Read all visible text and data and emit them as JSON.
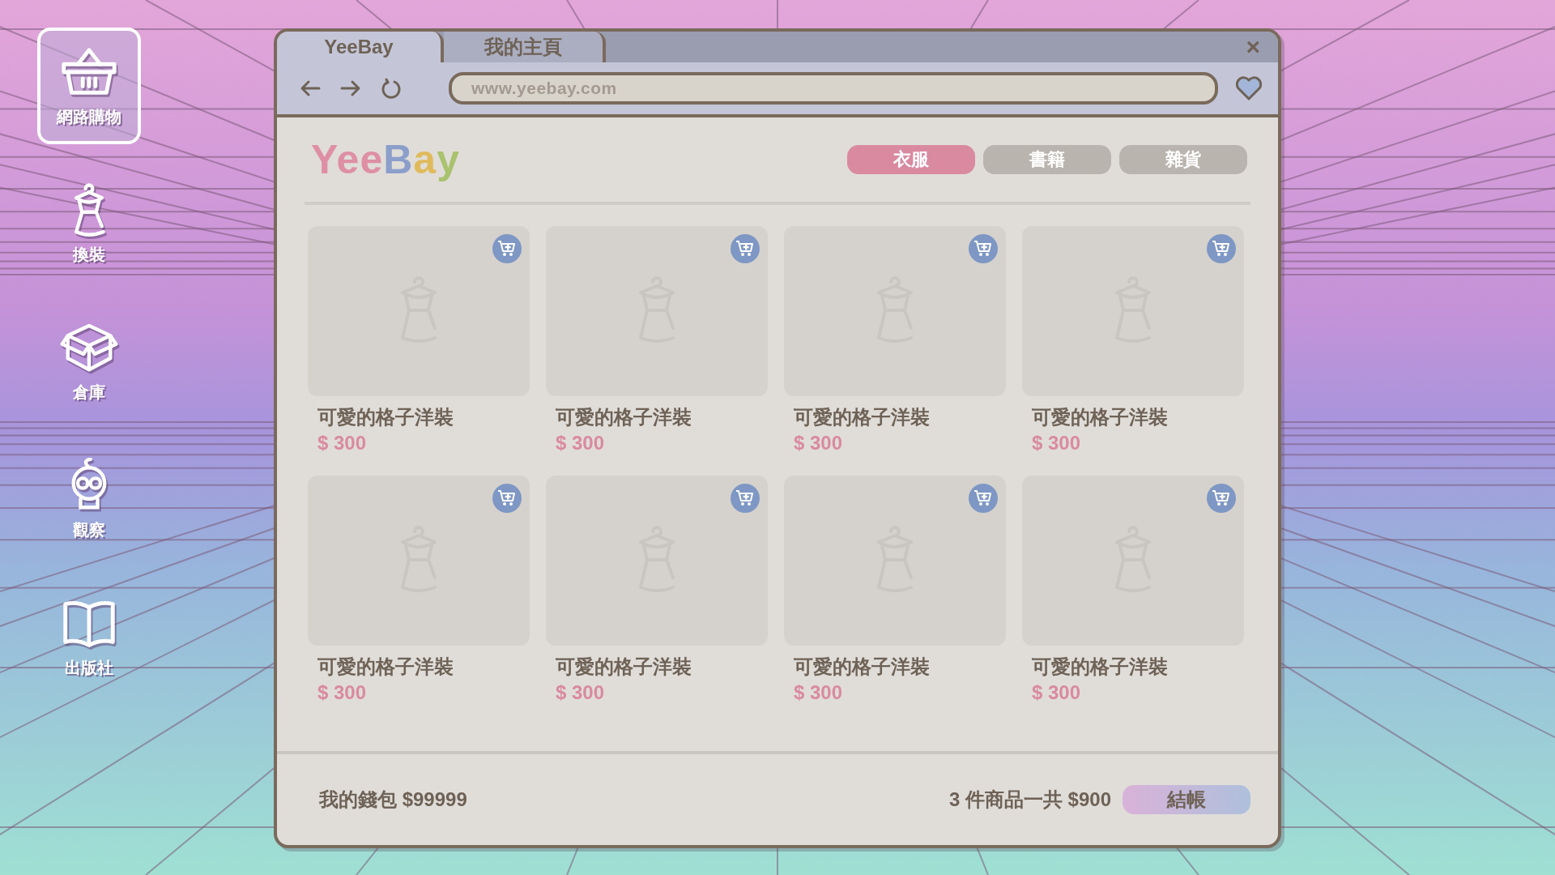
{
  "sidebar": {
    "items": [
      {
        "kind": "basket",
        "label": "網路購物",
        "selected": true
      },
      {
        "kind": "dress",
        "label": "換裝",
        "selected": false
      },
      {
        "kind": "box",
        "label": "倉庫",
        "selected": false
      },
      {
        "kind": "person",
        "label": "觀察",
        "selected": false
      },
      {
        "kind": "book",
        "label": "出版社",
        "selected": false
      }
    ]
  },
  "browser": {
    "tabs": [
      {
        "label": "YeeBay",
        "selected": true
      },
      {
        "label": "我的主頁",
        "selected": false
      }
    ],
    "close": "×",
    "url": "www.yeebay.com"
  },
  "shop": {
    "logo": [
      {
        "text": "Yee",
        "color": "#de8fa6"
      },
      {
        "text": "B",
        "color": "#8c9fca"
      },
      {
        "text": "a",
        "color": "#e0bb5c"
      },
      {
        "text": "y",
        "color": "#a9c26d"
      }
    ],
    "categories": [
      {
        "label": "衣服",
        "selected": true
      },
      {
        "label": "書籍",
        "selected": false
      },
      {
        "label": "雜貨",
        "selected": false
      }
    ],
    "products": [
      {
        "name": "可愛的格子洋裝",
        "price": "$ 300"
      },
      {
        "name": "可愛的格子洋裝",
        "price": "$ 300"
      },
      {
        "name": "可愛的格子洋裝",
        "price": "$ 300"
      },
      {
        "name": "可愛的格子洋裝",
        "price": "$ 300"
      },
      {
        "name": "可愛的格子洋裝",
        "price": "$ 300"
      },
      {
        "name": "可愛的格子洋裝",
        "price": "$ 300"
      },
      {
        "name": "可愛的格子洋裝",
        "price": "$ 300"
      },
      {
        "name": "可愛的格子洋裝",
        "price": "$ 300"
      }
    ]
  },
  "footer": {
    "wallet": "我的錢包 $99999",
    "summary": "3 件商品一共 $900",
    "checkout": "結帳"
  }
}
